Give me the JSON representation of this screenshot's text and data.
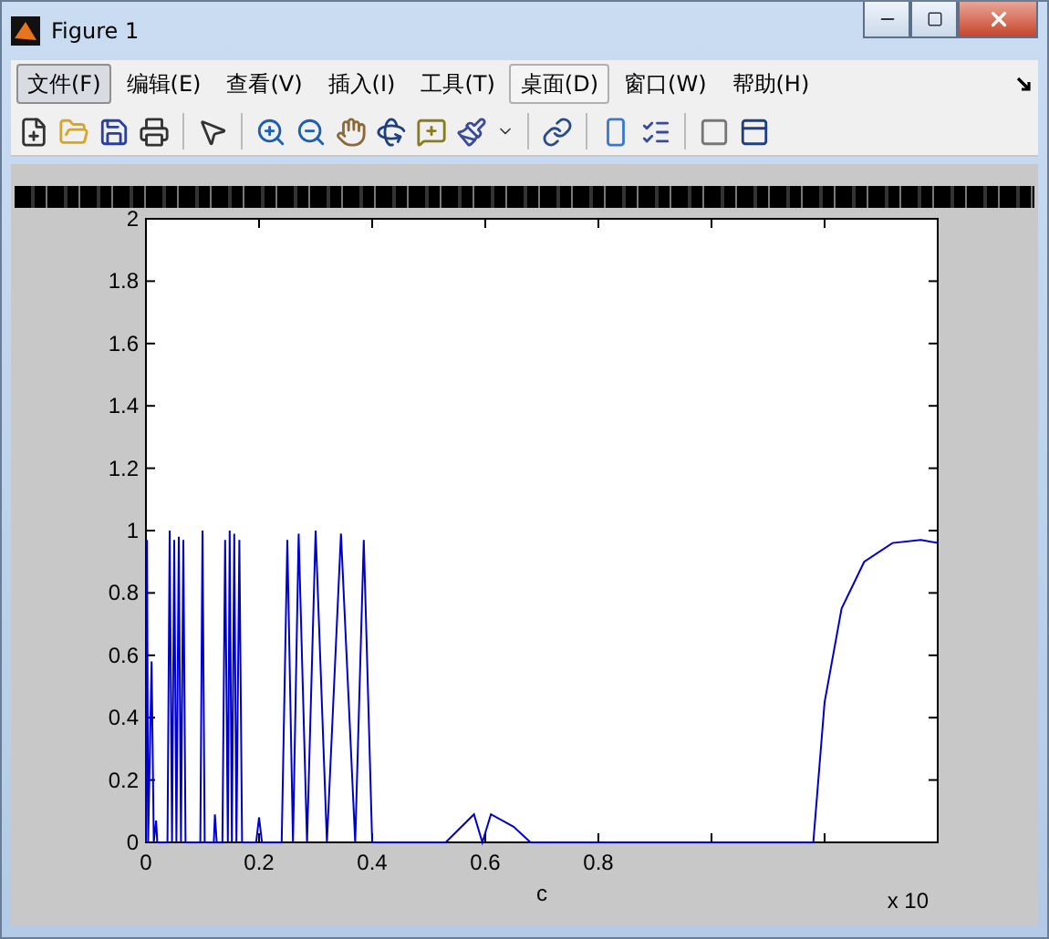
{
  "window": {
    "title": "Figure 1"
  },
  "menu": [
    {
      "label": "文件(F)",
      "selected": true,
      "outlined": false
    },
    {
      "label": "编辑(E)",
      "selected": false,
      "outlined": false
    },
    {
      "label": "查看(V)",
      "selected": false,
      "outlined": false
    },
    {
      "label": "插入(I)",
      "selected": false,
      "outlined": false
    },
    {
      "label": "工具(T)",
      "selected": false,
      "outlined": false
    },
    {
      "label": "桌面(D)",
      "selected": false,
      "outlined": true
    },
    {
      "label": "窗口(W)",
      "selected": false,
      "outlined": false
    },
    {
      "label": "帮助(H)",
      "selected": false,
      "outlined": false
    }
  ],
  "plot": {
    "x_multiplier": "x 10",
    "chart_data": {
      "type": "line",
      "xlabel": "c",
      "xlim": [
        0,
        1.4
      ],
      "ylim": [
        0,
        2
      ],
      "xticks": [
        0,
        0.2,
        0.4,
        0.6,
        0.8
      ],
      "yticks": [
        0,
        0.2,
        0.4,
        0.6,
        0.8,
        1,
        1.2,
        1.4,
        1.6,
        1.8,
        2
      ],
      "x": [
        0,
        0.002,
        0.004,
        0.01,
        0.014,
        0.018,
        0.02,
        0.038,
        0.042,
        0.046,
        0.05,
        0.054,
        0.058,
        0.062,
        0.066,
        0.07,
        0.096,
        0.1,
        0.104,
        0.12,
        0.122,
        0.125,
        0.135,
        0.14,
        0.145,
        0.148,
        0.152,
        0.156,
        0.16,
        0.165,
        0.17,
        0.195,
        0.2,
        0.205,
        0.24,
        0.25,
        0.26,
        0.27,
        0.285,
        0.3,
        0.32,
        0.345,
        0.37,
        0.385,
        0.4,
        0.53,
        0.58,
        0.595,
        0.61,
        0.65,
        0.68,
        1.18,
        1.2,
        1.23,
        1.27,
        1.32,
        1.37,
        1.4
      ],
      "series": [
        {
          "color": "#0000cc",
          "values": [
            0,
            0.97,
            0,
            0.58,
            0,
            0.07,
            0,
            0,
            1,
            0,
            0.97,
            0,
            0.98,
            0,
            0.97,
            0,
            0,
            1,
            0,
            0,
            0.09,
            0,
            0,
            0.97,
            0,
            1,
            0,
            0.99,
            0,
            0.97,
            0,
            0,
            0.08,
            0,
            0,
            0.97,
            0,
            0.99,
            0,
            1,
            0,
            0.99,
            0,
            0.97,
            0,
            0,
            0.09,
            0,
            0.09,
            0.05,
            0,
            0,
            0.45,
            0.75,
            0.9,
            0.96,
            0.97,
            0.96
          ]
        }
      ]
    }
  }
}
